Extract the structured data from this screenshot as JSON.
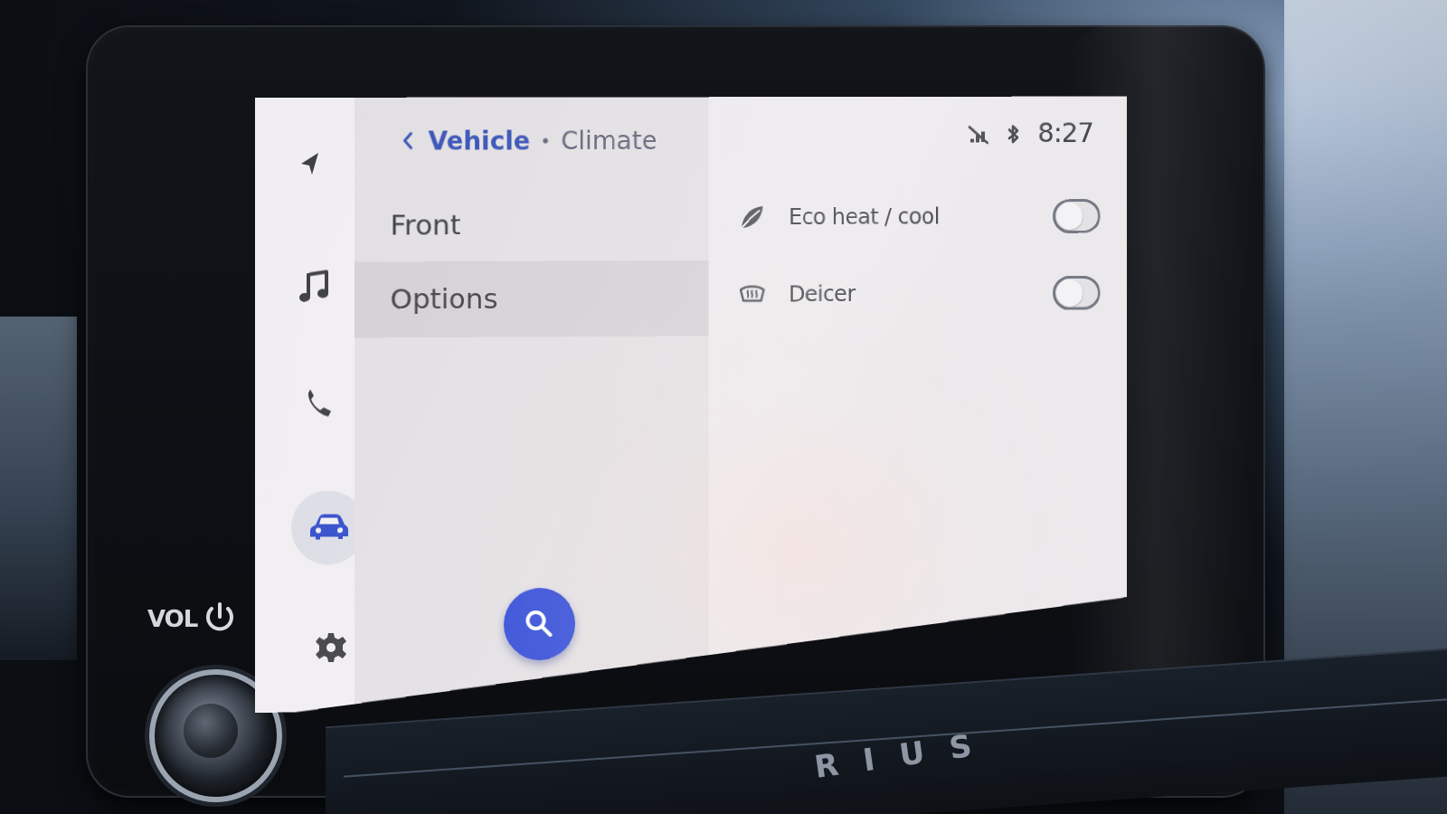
{
  "hardware": {
    "vol_label": "VOL",
    "brand_text": "RIUS"
  },
  "navigation_rail": {
    "items": [
      {
        "name": "Navigation",
        "icon": "navigation-arrow-icon",
        "active": false
      },
      {
        "name": "Music",
        "icon": "music-note-icon",
        "active": false
      },
      {
        "name": "Phone",
        "icon": "phone-icon",
        "active": false
      },
      {
        "name": "Vehicle",
        "icon": "car-icon",
        "active": true
      },
      {
        "name": "Settings",
        "icon": "gear-icon",
        "active": false
      }
    ]
  },
  "breadcrumb": {
    "parent": "Vehicle",
    "current": "Climate"
  },
  "status": {
    "time": "8:27",
    "icons": [
      "no-signal-icon",
      "bluetooth-icon"
    ]
  },
  "left_menu": {
    "items": [
      {
        "label": "Front",
        "selected": false
      },
      {
        "label": "Options",
        "selected": true
      }
    ]
  },
  "settings": {
    "items": [
      {
        "label": "Eco heat / cool",
        "icon": "leaf-icon",
        "enabled": false
      },
      {
        "label": "Deicer",
        "icon": "windshield-heater-icon",
        "enabled": false
      }
    ]
  },
  "colors": {
    "accent": "#2742d6",
    "link": "#3550b5"
  }
}
